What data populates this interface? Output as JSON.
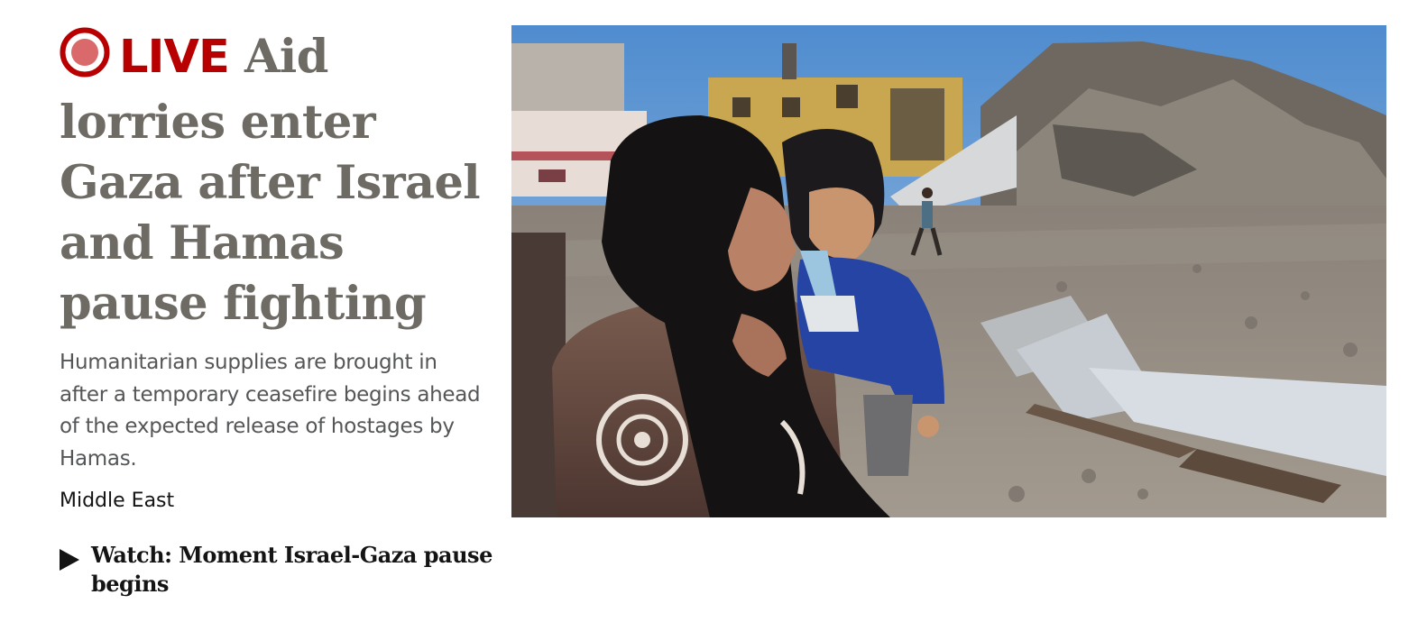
{
  "story": {
    "live_label": "LIVE",
    "headline": "Aid lorries enter Gaza after Israel and Hamas pause fighting",
    "summary": "Humanitarian supplies are brought in after a temporary ceasefire begins ahead of the expected release of hostages by Hamas.",
    "section": "Middle East",
    "image_subject": "woman in black headscarf holding a child amid destroyed buildings and rubble"
  },
  "related": {
    "icon": "play-icon",
    "title": "Watch: Moment Israel-Gaza pause begins"
  },
  "colors": {
    "live_red": "#b80000",
    "headline_grey": "#6e6a64",
    "summary_grey": "#545658",
    "text_dark": "#141414"
  }
}
